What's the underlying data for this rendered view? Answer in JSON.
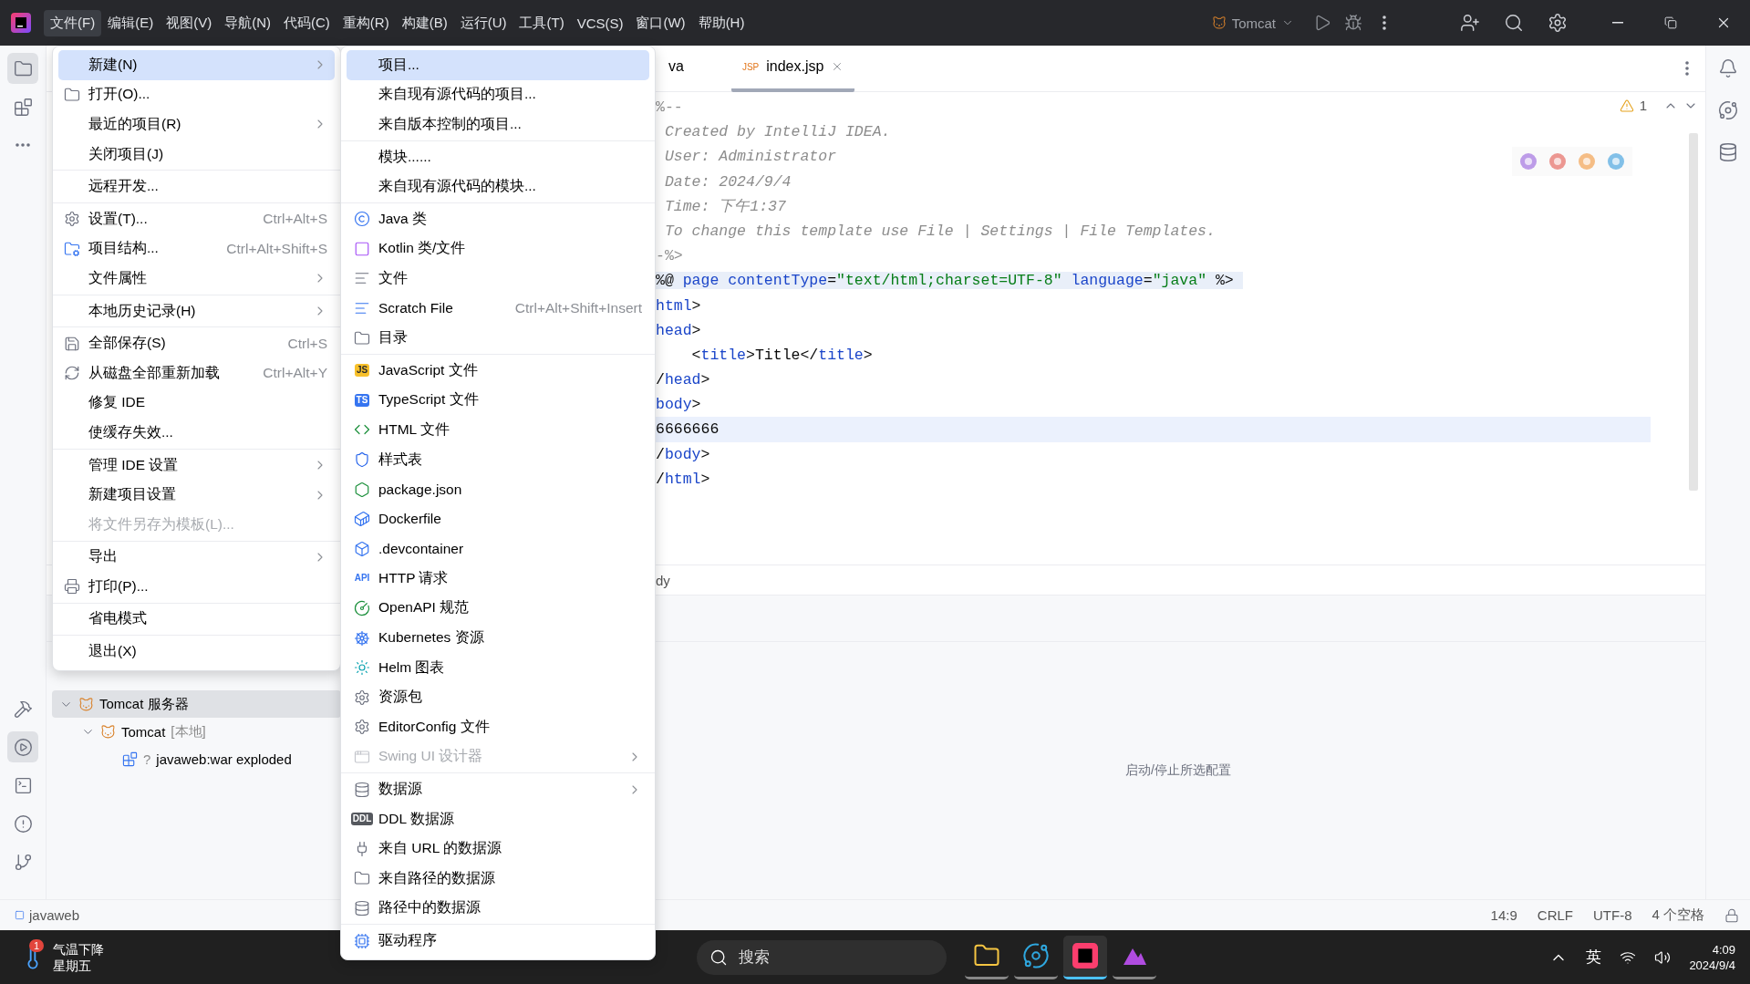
{
  "titlebar": {
    "menus": [
      "文件(F)",
      "编辑(E)",
      "视图(V)",
      "导航(N)",
      "代码(C)",
      "重构(R)",
      "构建(B)",
      "运行(U)",
      "工具(T)",
      "VCS(S)",
      "窗口(W)",
      "帮助(H)"
    ],
    "run_config": "Tomcat"
  },
  "left_toolbar": [
    {
      "selected": true
    },
    {
      "selected": false
    },
    {
      "selected": false
    },
    {
      "selected": false
    },
    {
      "selected": true
    },
    {
      "selected": false
    },
    {
      "selected": false
    },
    {
      "selected": false
    }
  ],
  "tabs": [
    {
      "label": "va",
      "selected": false
    },
    {
      "icon_text": "JSP",
      "label": "index.jsp",
      "selected": true
    }
  ],
  "inspection": {
    "count": "1"
  },
  "code_lines": [
    {
      "shaded": false,
      "current": false,
      "tokens": [
        {
          "kind": "delim",
          "t": "%--"
        }
      ]
    },
    {
      "shaded": false,
      "current": false,
      "tokens": [
        {
          "kind": "comment",
          "t": " Created by IntelliJ IDEA."
        }
      ]
    },
    {
      "shaded": false,
      "current": false,
      "tokens": [
        {
          "kind": "comment",
          "t": " User: Administrator"
        }
      ]
    },
    {
      "shaded": false,
      "current": false,
      "tokens": [
        {
          "kind": "comment",
          "t": " Date: 2024/9/4"
        }
      ]
    },
    {
      "shaded": false,
      "current": false,
      "tokens": [
        {
          "kind": "comment",
          "t": " Time: 下午1:37"
        }
      ]
    },
    {
      "shaded": false,
      "current": false,
      "tokens": [
        {
          "kind": "comment",
          "t": " To change this template use File | Settings | File Templates."
        }
      ]
    },
    {
      "shaded": false,
      "current": false,
      "tokens": [
        {
          "kind": "delim",
          "t": "-%>"
        }
      ]
    },
    {
      "shaded": true,
      "current": false,
      "tokens": [
        {
          "kind": "text",
          "t": "%@ "
        },
        {
          "kind": "tag",
          "t": "page "
        },
        {
          "kind": "tag",
          "t": "contentType"
        },
        {
          "kind": "text",
          "t": "="
        },
        {
          "kind": "string",
          "t": "\"text/html;charset=UTF-8\""
        },
        {
          "kind": "tag",
          "t": " language"
        },
        {
          "kind": "text",
          "t": "="
        },
        {
          "kind": "string",
          "t": "\"java\""
        },
        {
          "kind": "text",
          "t": " %>"
        }
      ]
    },
    {
      "shaded": false,
      "current": false,
      "tokens": [
        {
          "kind": "tag",
          "t": "html"
        },
        {
          "kind": "text",
          "t": ">"
        }
      ]
    },
    {
      "shaded": false,
      "current": false,
      "tokens": [
        {
          "kind": "tag",
          "t": "head"
        },
        {
          "kind": "text",
          "t": ">"
        }
      ]
    },
    {
      "shaded": false,
      "current": false,
      "tokens": [
        {
          "kind": "text",
          "t": "    <"
        },
        {
          "kind": "tag",
          "t": "title"
        },
        {
          "kind": "text",
          "t": ">Title</"
        },
        {
          "kind": "tag",
          "t": "title"
        },
        {
          "kind": "text",
          "t": ">"
        }
      ]
    },
    {
      "shaded": false,
      "current": false,
      "tokens": [
        {
          "kind": "text",
          "t": "/"
        },
        {
          "kind": "tag",
          "t": "head"
        },
        {
          "kind": "text",
          "t": ">"
        }
      ]
    },
    {
      "shaded": false,
      "current": false,
      "tokens": [
        {
          "kind": "tag",
          "t": "body"
        },
        {
          "kind": "text",
          "t": ">"
        }
      ]
    },
    {
      "shaded": false,
      "current": true,
      "tokens": [
        {
          "kind": "text",
          "t": "6666666"
        }
      ]
    },
    {
      "shaded": false,
      "current": false,
      "tokens": [
        {
          "kind": "text",
          "t": "/"
        },
        {
          "kind": "tag",
          "t": "body"
        },
        {
          "kind": "text",
          "t": ">"
        }
      ]
    },
    {
      "shaded": false,
      "current": false,
      "tokens": [
        {
          "kind": "text",
          "t": "/"
        },
        {
          "kind": "tag",
          "t": "html"
        },
        {
          "kind": "text",
          "t": ">"
        }
      ]
    }
  ],
  "breadcrumb": "dy",
  "services": {
    "tree": [
      {
        "label": "Tomcat 服务器",
        "selected": true,
        "expanded": true,
        "children": [
          {
            "label": "Tomcat",
            "suffix": "[本地]",
            "selected": false,
            "expanded": true,
            "children": [
              {
                "prefix": "?",
                "label": "javaweb:war exploded",
                "selected": false
              }
            ]
          }
        ]
      }
    ],
    "hint": "启动/停止所选配置"
  },
  "file_menu": {
    "groups": [
      [
        {
          "label": "新建(N)",
          "submenu": true,
          "selected": true,
          "disabled": false
        },
        {
          "label": "打开(O)...",
          "submenu": false,
          "selected": false,
          "disabled": false
        },
        {
          "label": "最近的项目(R)",
          "submenu": true,
          "selected": false,
          "disabled": false
        },
        {
          "label": "关闭项目(J)",
          "submenu": false,
          "selected": false,
          "disabled": false
        }
      ],
      [
        {
          "label": "远程开发...",
          "submenu": false,
          "selected": false,
          "disabled": false
        }
      ],
      [
        {
          "label": "设置(T)...",
          "shortcut": "Ctrl+Alt+S",
          "submenu": false,
          "selected": false,
          "disabled": false
        },
        {
          "label": "项目结构...",
          "shortcut": "Ctrl+Alt+Shift+S",
          "submenu": false,
          "selected": false,
          "disabled": false
        },
        {
          "label": "文件属性",
          "submenu": true,
          "selected": false,
          "disabled": false
        }
      ],
      [
        {
          "label": "本地历史记录(H)",
          "submenu": true,
          "selected": false,
          "disabled": false
        }
      ],
      [
        {
          "label": "全部保存(S)",
          "shortcut": "Ctrl+S",
          "submenu": false,
          "selected": false,
          "disabled": false
        },
        {
          "label": "从磁盘全部重新加载",
          "shortcut": "Ctrl+Alt+Y",
          "submenu": false,
          "selected": false,
          "disabled": false
        },
        {
          "label": "修复 IDE",
          "submenu": false,
          "selected": false,
          "disabled": false
        },
        {
          "label": "使缓存失效...",
          "submenu": false,
          "selected": false,
          "disabled": false
        }
      ],
      [
        {
          "label": "管理 IDE 设置",
          "submenu": true,
          "selected": false,
          "disabled": false
        },
        {
          "label": "新建项目设置",
          "submenu": true,
          "selected": false,
          "disabled": false
        },
        {
          "label": "将文件另存为模板(L)...",
          "submenu": false,
          "selected": false,
          "disabled": true
        }
      ],
      [
        {
          "label": "导出",
          "submenu": true,
          "selected": false,
          "disabled": false
        },
        {
          "label": "打印(P)...",
          "submenu": false,
          "selected": false,
          "disabled": false
        }
      ],
      [
        {
          "label": "省电模式",
          "submenu": false,
          "selected": false,
          "disabled": false
        }
      ],
      [
        {
          "label": "退出(X)",
          "submenu": false,
          "selected": false,
          "disabled": false
        }
      ]
    ]
  },
  "new_submenu": {
    "groups": [
      [
        {
          "label": "项目...",
          "selected": true,
          "disabled": false,
          "submenu": false
        },
        {
          "label": "来自现有源代码的项目...",
          "selected": false,
          "disabled": false,
          "submenu": false
        },
        {
          "label": "来自版本控制的项目...",
          "selected": false,
          "disabled": false,
          "submenu": false
        }
      ],
      [
        {
          "label": "模块......",
          "selected": false,
          "disabled": false,
          "submenu": false
        },
        {
          "label": "来自现有源代码的模块...",
          "selected": false,
          "disabled": false,
          "submenu": false
        }
      ],
      [
        {
          "label": "Java 类",
          "selected": false,
          "disabled": false,
          "submenu": false
        },
        {
          "label": "Kotlin 类/文件",
          "selected": false,
          "disabled": false,
          "submenu": false
        },
        {
          "label": "文件",
          "selected": false,
          "disabled": false,
          "submenu": false
        },
        {
          "label": "Scratch File",
          "shortcut": "Ctrl+Alt+Shift+Insert",
          "selected": false,
          "disabled": false,
          "submenu": false
        },
        {
          "label": "目录",
          "selected": false,
          "disabled": false,
          "submenu": false
        }
      ],
      [
        {
          "badge": "JS",
          "label": "JavaScript 文件",
          "selected": false,
          "disabled": false,
          "submenu": false
        },
        {
          "badge": "TS",
          "label": "TypeScript 文件",
          "selected": false,
          "disabled": false,
          "submenu": false
        },
        {
          "label": "HTML 文件",
          "selected": false,
          "disabled": false,
          "submenu": false
        },
        {
          "label": "样式表",
          "selected": false,
          "disabled": false,
          "submenu": false
        },
        {
          "label": "package.json",
          "selected": false,
          "disabled": false,
          "submenu": false
        },
        {
          "label": "Dockerfile",
          "selected": false,
          "disabled": false,
          "submenu": false
        },
        {
          "label": ".devcontainer",
          "selected": false,
          "disabled": false,
          "submenu": false
        },
        {
          "badge": "API",
          "label": "HTTP 请求",
          "selected": false,
          "disabled": false,
          "submenu": false
        },
        {
          "label": "OpenAPI 规范",
          "selected": false,
          "disabled": false,
          "submenu": false
        },
        {
          "label": "Kubernetes 资源",
          "selected": false,
          "disabled": false,
          "submenu": false
        },
        {
          "label": "Helm 图表",
          "selected": false,
          "disabled": false,
          "submenu": false
        },
        {
          "label": "资源包",
          "selected": false,
          "disabled": false,
          "submenu": false
        },
        {
          "label": "EditorConfig 文件",
          "selected": false,
          "disabled": false,
          "submenu": false
        },
        {
          "label": "Swing UI 设计器",
          "selected": false,
          "disabled": true,
          "submenu": true
        }
      ],
      [
        {
          "label": "数据源",
          "selected": false,
          "disabled": false,
          "submenu": true
        },
        {
          "badge": "DDL",
          "label": "DDL 数据源",
          "selected": false,
          "disabled": false,
          "submenu": false
        },
        {
          "label": "来自 URL 的数据源",
          "selected": false,
          "disabled": false,
          "submenu": false
        },
        {
          "label": "来自路径的数据源",
          "selected": false,
          "disabled": false,
          "submenu": false
        },
        {
          "label": "路径中的数据源",
          "selected": false,
          "disabled": false,
          "submenu": false
        }
      ],
      [
        {
          "label": "驱动程序",
          "selected": false,
          "disabled": false,
          "submenu": false
        }
      ]
    ]
  },
  "status_bar": {
    "project": "javaweb",
    "items": [
      "14:9",
      "CRLF",
      "UTF-8",
      "4 个空格"
    ]
  },
  "taskbar": {
    "weather": {
      "badge": "1",
      "title": "气温下降",
      "subtitle": "星期五"
    },
    "search": {
      "placeholder": "搜索"
    },
    "apps": [
      {
        "selected": false
      },
      {
        "selected": false
      },
      {
        "selected": true
      },
      {
        "selected": false
      }
    ],
    "tray": {
      "ime": "英",
      "time": "4:09",
      "date": "2024/9/4"
    }
  }
}
